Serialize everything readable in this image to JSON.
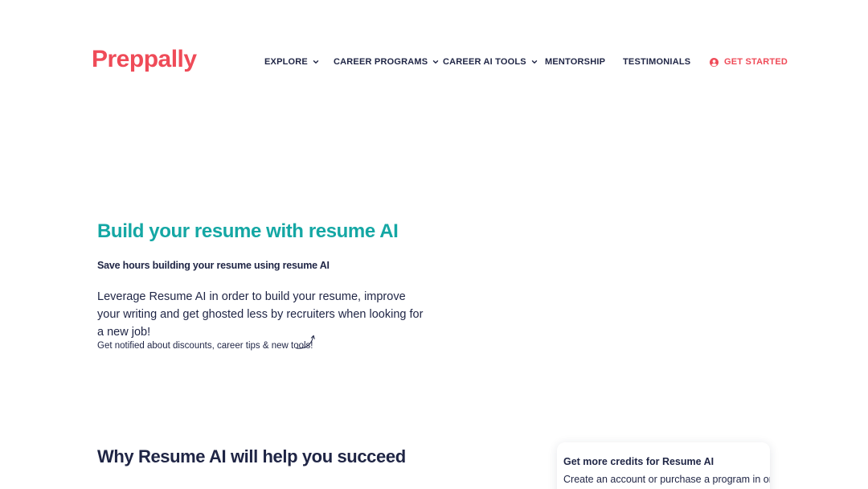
{
  "brand": {
    "logo_text": "Preppally",
    "logo_color": "#ef4b58"
  },
  "nav": {
    "items": [
      {
        "label": "EXPLORE",
        "dropdown": true
      },
      {
        "label": "CAREER PROGRAMS",
        "dropdown": true
      },
      {
        "label": "CAREER AI TOOLS",
        "dropdown": true
      },
      {
        "label": "MENTORSHIP",
        "dropdown": false
      },
      {
        "label": "TESTIMONIALS",
        "dropdown": false
      }
    ],
    "cta": {
      "label": "GET STARTED",
      "icon": "user-circle-icon",
      "color": "#ef4b58"
    }
  },
  "hero": {
    "title": "Build your resume with resume AI",
    "subtitle": "Save hours building your resume using resume AI",
    "description": "Leverage Resume AI in order to build your resume, improve your writing and get ghosted less by recruiters when looking for a new job!",
    "notify_text": "Get notified about discounts, career tips & new tools!",
    "title_color": "#14a7a4"
  },
  "why": {
    "title": "Why Resume AI will help you succeed",
    "text_color": "#1f2545"
  },
  "credits_card": {
    "title": "Get more credits for Resume AI",
    "text": "Create an account or purchase a program in order"
  }
}
